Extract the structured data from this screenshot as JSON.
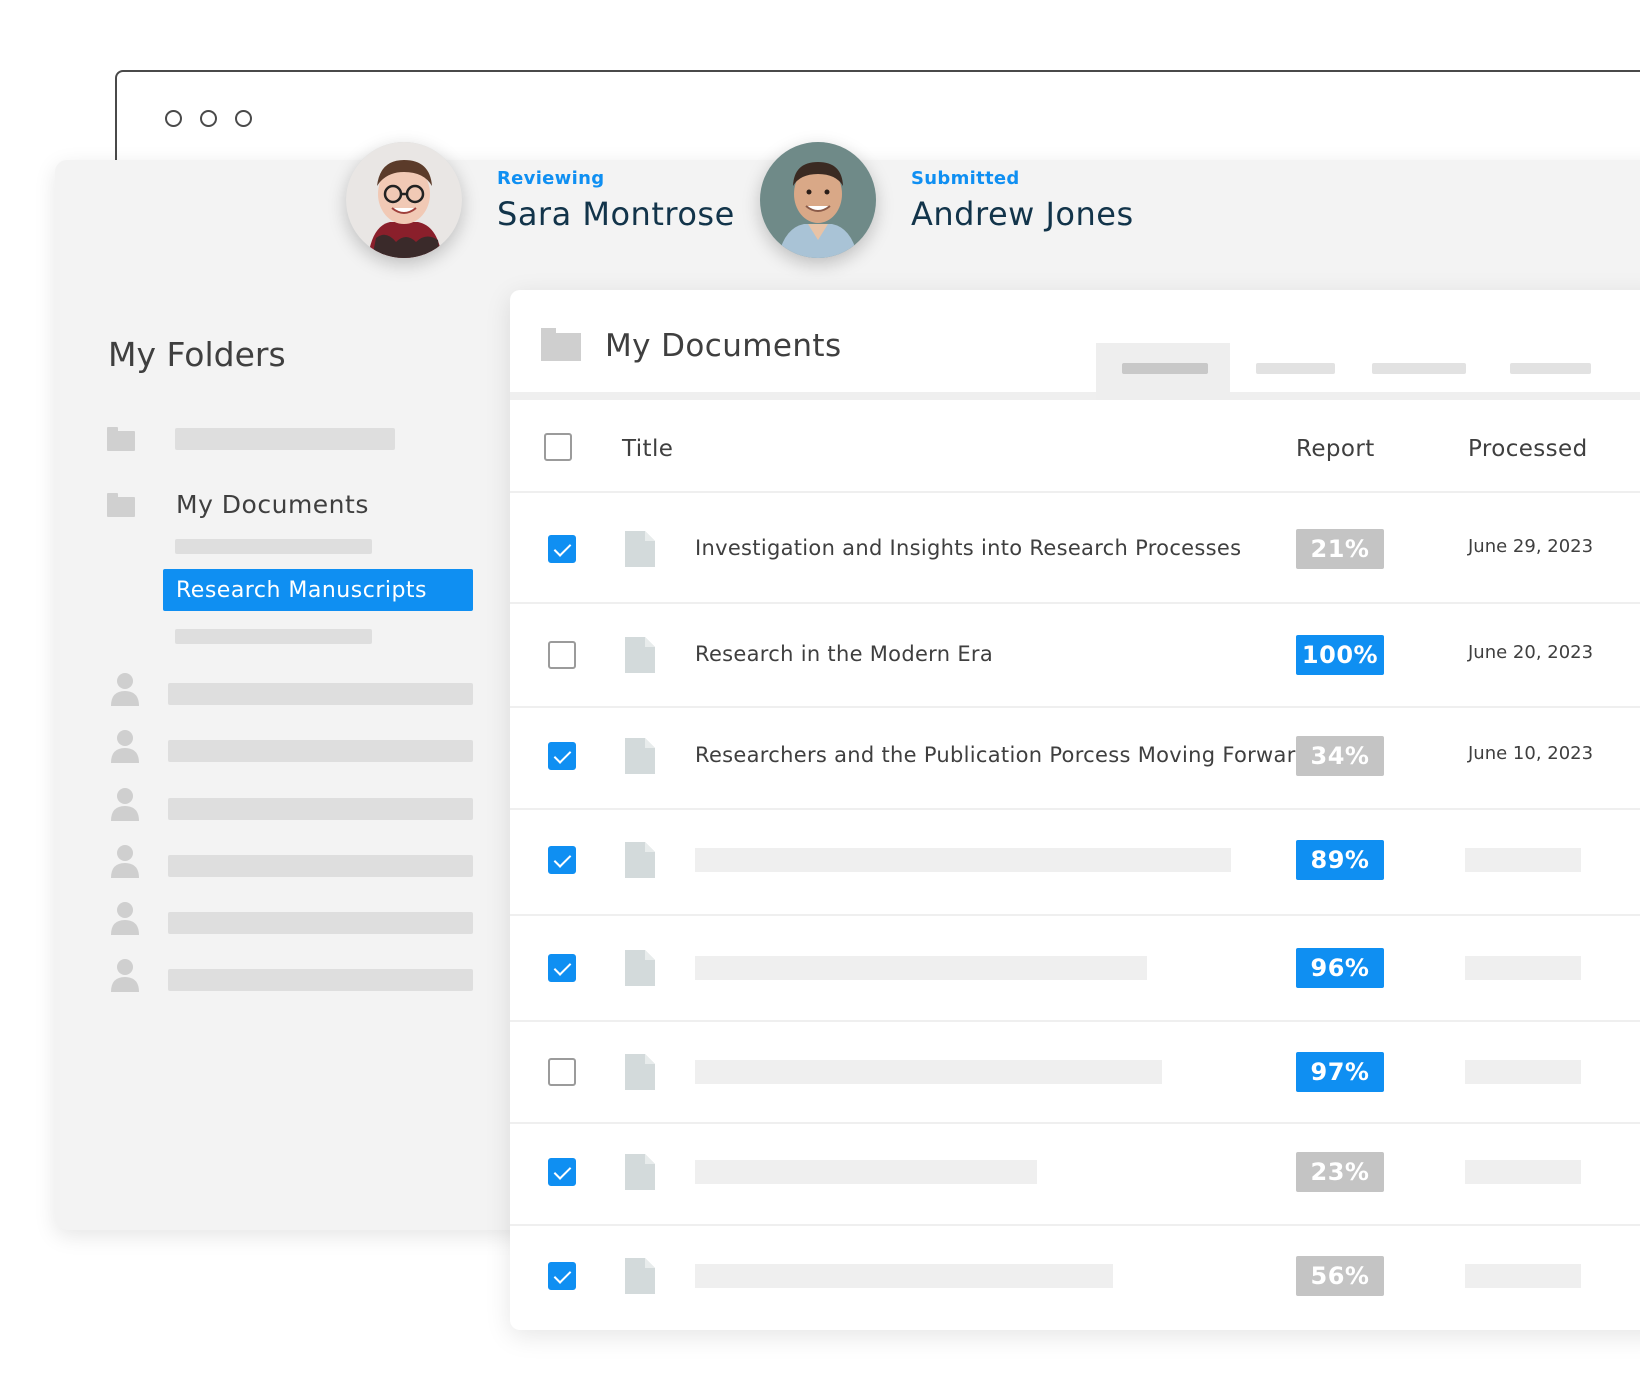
{
  "reviewers": [
    {
      "status": "Reviewing",
      "name": "Sara Montrose"
    },
    {
      "status": "Submitted",
      "name": "Andrew Jones"
    }
  ],
  "sidebar": {
    "title": "My Folders",
    "documents_label": "My Documents",
    "active_item": "Research Manuscripts"
  },
  "documents": {
    "title": "My Documents",
    "columns": {
      "title": "Title",
      "report": "Report",
      "processed": "Processed"
    },
    "rows": [
      {
        "checked": true,
        "title": "Investigation and Insights into Research Processes",
        "report": "21%",
        "report_color": "gray",
        "processed": "June 29, 2023"
      },
      {
        "checked": false,
        "title": "Research in the Modern Era",
        "report": "100%",
        "report_color": "blue",
        "processed": "June 20, 2023"
      },
      {
        "checked": true,
        "title": "Researchers and the Publication Porcess Moving Forward",
        "report": "34%",
        "report_color": "gray",
        "processed": "June 10, 2023"
      },
      {
        "checked": true,
        "title": "",
        "report": "89%",
        "report_color": "blue",
        "processed": ""
      },
      {
        "checked": true,
        "title": "",
        "report": "96%",
        "report_color": "blue",
        "processed": ""
      },
      {
        "checked": false,
        "title": "",
        "report": "97%",
        "report_color": "blue",
        "processed": ""
      },
      {
        "checked": true,
        "title": "",
        "report": "23%",
        "report_color": "gray",
        "processed": ""
      },
      {
        "checked": true,
        "title": "",
        "report": "56%",
        "report_color": "gray",
        "processed": ""
      }
    ]
  },
  "colors": {
    "accent": "#0f8ff2",
    "badge_gray": "#c4c4c4",
    "name_text": "#12344a"
  },
  "icons": [
    "folder-icon",
    "user-icon",
    "file-icon",
    "checkbox-check-icon"
  ]
}
